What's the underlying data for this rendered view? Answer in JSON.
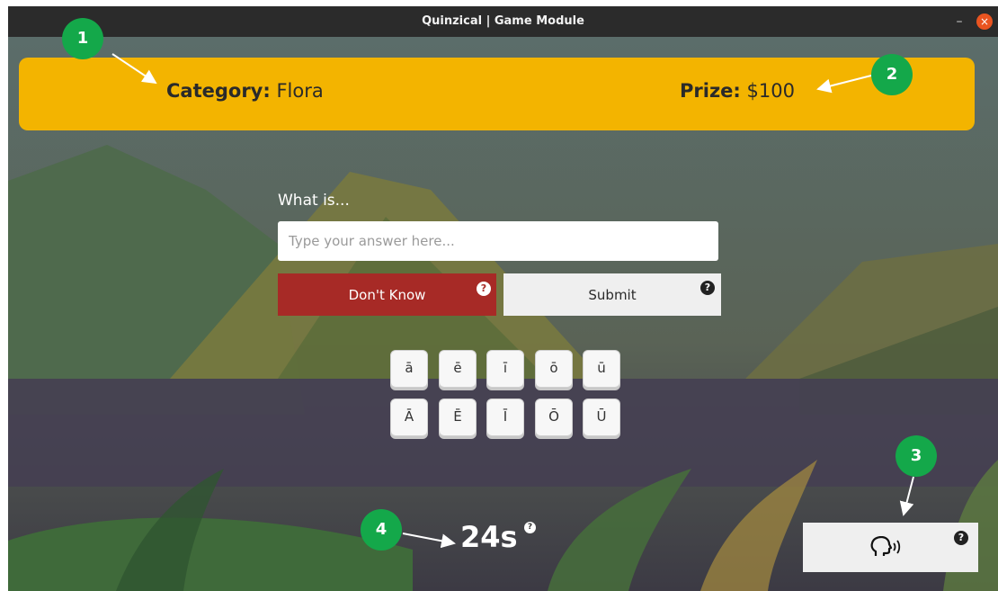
{
  "window": {
    "title": "Quinzical | Game Module",
    "minimize_glyph": "–",
    "close_glyph": "×"
  },
  "header": {
    "category_label": "Category:",
    "category_value": "Flora",
    "prize_label": "Prize:",
    "prize_value": "$100"
  },
  "question": {
    "prompt": "What is...",
    "answer_value": "",
    "answer_placeholder": "Type your answer here..."
  },
  "buttons": {
    "dont_know": "Don't Know",
    "submit": "Submit",
    "help_glyph": "?"
  },
  "macron_keys": {
    "lower": [
      "ā",
      "ē",
      "ī",
      "ō",
      "ū"
    ],
    "upper": [
      "Ā",
      "Ē",
      "Ī",
      "Ō",
      "Ū"
    ]
  },
  "timer": {
    "text": "24s"
  },
  "speak_button": {
    "icon": "speaking-head-icon"
  },
  "callouts": [
    "1",
    "2",
    "3",
    "4"
  ],
  "colors": {
    "banner": "#f3b400",
    "dont_know": "#a72a26",
    "submit": "#efefef",
    "callout": "#14a84a"
  }
}
